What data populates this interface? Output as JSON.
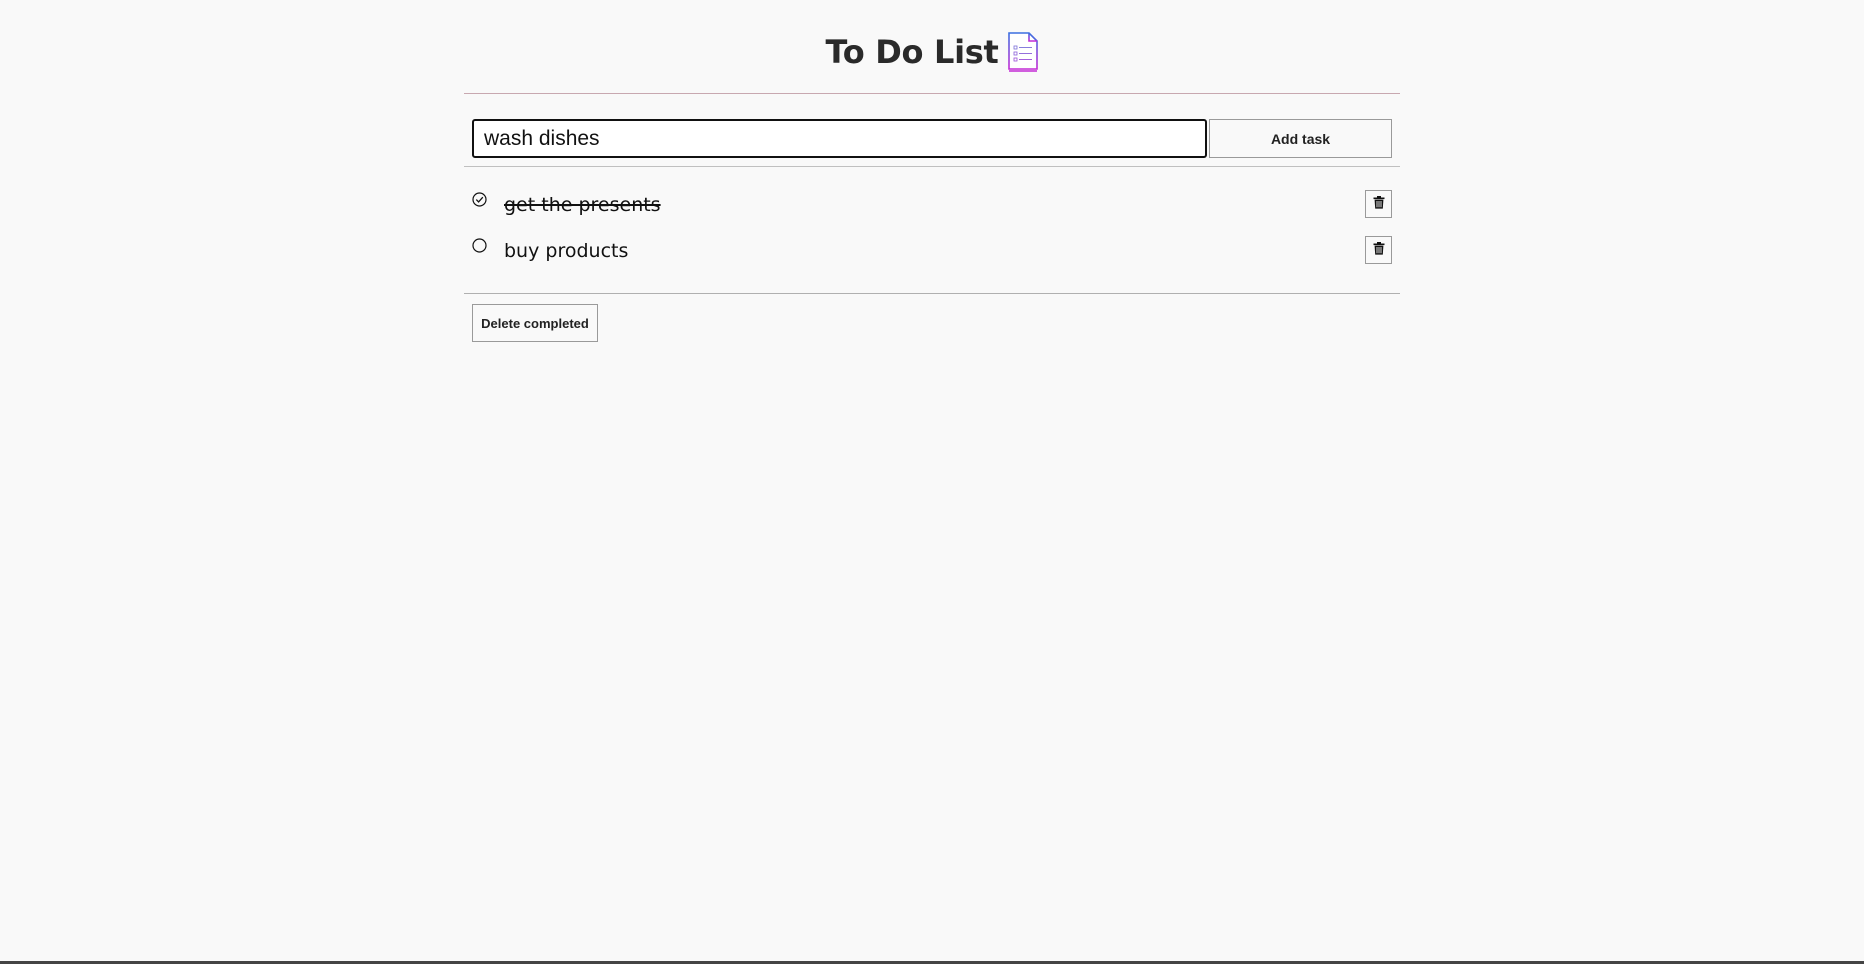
{
  "header": {
    "title": "To Do List",
    "icon": "document-list-icon"
  },
  "form": {
    "input_value": "wash dishes",
    "add_button_label": "Add task"
  },
  "tasks": [
    {
      "text": "get the presents",
      "completed": true
    },
    {
      "text": "buy products",
      "completed": false
    }
  ],
  "footer": {
    "delete_completed_label": "Delete completed"
  },
  "colors": {
    "background": "#f9f9f9",
    "icon_gradient_start": "#3b6fe0",
    "icon_gradient_end": "#c42bd6"
  }
}
